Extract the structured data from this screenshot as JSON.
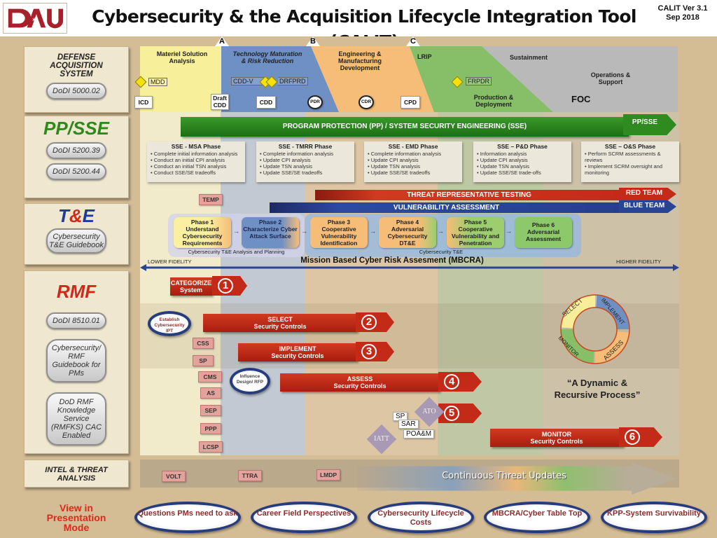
{
  "header": {
    "logo_text": "DAU",
    "title": "Cybersecurity & the Acquisition Lifecycle Integration Tool (CALIT)",
    "version_line1": "CALIT Ver 3.1",
    "version_line2": "Sep 2018"
  },
  "left_panel": {
    "das": {
      "title_lines": [
        "DEFENSE",
        "ACQUISITION",
        "SYSTEM"
      ],
      "buttons": [
        "DoDI 5000.02"
      ]
    },
    "ppsse": {
      "title": "PP/SSE",
      "buttons": [
        "DoDI 5200.39",
        "DoDI 5200.44"
      ]
    },
    "te": {
      "title_t": "T",
      "title_amp": "&",
      "title_e": "E",
      "buttons": [
        "Cybersecurity T&E Guidebook"
      ]
    },
    "rmf": {
      "title": "RMF",
      "buttons": [
        "DoDI 8510.01",
        "Cybersecurity/ RMF Guidebook for PMs",
        "DoD RMF Knowledge Service (RMFKS) CAC Enabled"
      ]
    },
    "intel": {
      "title": "INTEL & THREAT ANALYSIS"
    },
    "presentation": "View in Presentation Mode"
  },
  "lifecycle": {
    "milestones": [
      "A",
      "B",
      "C"
    ],
    "phases": [
      {
        "name": "Materiel Solution Analysis",
        "color": "#f8ef9a"
      },
      {
        "name": "Technology Maturation & Risk Reduction",
        "color": "#6f90c4"
      },
      {
        "name": "Engineering & Manufacturing Development",
        "color": "#f6bd78"
      },
      {
        "name": "LRIP",
        "color": "#86bf68"
      },
      {
        "name": "Sustainment",
        "color": "#b9b9b9"
      }
    ],
    "production": "Production & Deployment",
    "ops": "Operations & Support",
    "foc": "FOC",
    "decision_points": [
      "MDD",
      "CDD-V",
      "DRFPRD",
      "FRPDR"
    ],
    "documents": [
      "ICD",
      "Draft CDD",
      "CDD",
      "CPD"
    ],
    "reviews": [
      "PDR",
      "CDR"
    ]
  },
  "ppsse": {
    "banner": "PROGRAM PROTECTION (PP) / SYSTEM SECURITY ENGINEERING (SSE)",
    "tag": "PP/SSE",
    "phases": [
      {
        "title": "SSE - MSA Phase",
        "items": [
          "Complete initial information analysis",
          "Conduct an initial CPI analysis",
          "Conduct an initial TSN analysis",
          "Conduct SSE/SE tradeoffs"
        ]
      },
      {
        "title": "SSE - TMRR Phase",
        "items": [
          "Complete information analysis",
          "Update CPI analysis",
          "Update TSN analysis",
          "Update SSE/SE tradeoffs"
        ]
      },
      {
        "title": "SSE - EMD Phase",
        "items": [
          "Complete information analysis",
          "Update CPI analysis",
          "Update TSN analysis",
          "Update SSE/SE tradeoffs"
        ]
      },
      {
        "title": "SSE – P&D Phase",
        "items": [
          "Information analysis",
          "Update CPI analysis",
          "Update TSN analysis",
          "Update SSE/SE trade-offs"
        ]
      },
      {
        "title": "SSE – O&S Phase",
        "items": [
          "Perform SCRM assessments & reviews",
          "Implement SCRM oversight and monitoring"
        ]
      }
    ]
  },
  "te": {
    "temp": "TEMP",
    "threat_bar": "THREAT REPRESENTATIVE TESTING",
    "red_team": "RED TEAM",
    "vuln_bar": "VULNERABILITY ASSESSMENT",
    "blue_team": "BLUE TEAM",
    "phases": [
      {
        "n": "Phase 1",
        "text": "Understand Cybersecurity Requirements"
      },
      {
        "n": "Phase 2",
        "text": "Characterize Cyber Attack Surface"
      },
      {
        "n": "Phase 3",
        "text": "Cooperative Vulnerability Identification"
      },
      {
        "n": "Phase 4",
        "text": "Adversarial Cybersecurity DT&E"
      },
      {
        "n": "Phase 5",
        "text": "Cooperative Vulnerability and Penetration"
      },
      {
        "n": "Phase 6",
        "text": "Adversarial Assessment"
      }
    ],
    "group1": "Cybersecurity T&E Analysis and Planning",
    "group2": "Cybersecurity T&E",
    "lower": "LOWER FIDELITY",
    "mbcra": "Mission Based Cyber Risk Assesment (MBCRA)",
    "higher": "HIGHER FIDELITY"
  },
  "rmf": {
    "steps": [
      {
        "num": "1",
        "l1": "CATEGORIZE",
        "l2": "System"
      },
      {
        "num": "2",
        "l1": "SELECT",
        "l2": "Security Controls"
      },
      {
        "num": "3",
        "l1": "IMPLEMENT",
        "l2": "Security Controls"
      },
      {
        "num": "4",
        "l1": "ASSESS",
        "l2": "Security Controls"
      },
      {
        "num": "5",
        "l1": "",
        "l2": ""
      },
      {
        "num": "6",
        "l1": "MONITOR",
        "l2": "Security Controls"
      }
    ],
    "establish_ipt": "Establish Cybersecurity IPT",
    "influence": "Influence Design/ RFP",
    "docs": [
      "CSS",
      "SP",
      "CMS",
      "AS",
      "SEP",
      "PPP",
      "LCSP"
    ],
    "ato": "ATO",
    "iatt": "IATT",
    "package": [
      "SP",
      "SAR",
      "POA&M"
    ],
    "cycle": [
      "SELECT",
      "IMPLEMENT",
      "ASSESS",
      "MONITOR"
    ],
    "cycle_caption": "“A Dynamic & Recursive Process”"
  },
  "intel": {
    "docs": [
      "VOLT",
      "TTRA",
      "LMDP"
    ],
    "continuous": "Continuous Threat Updates"
  },
  "bottom_links": [
    "Questions PMs need to ask",
    "Career Field Perspectives",
    "Cybersecurity Lifecycle Costs",
    "MBCRA/Cyber Table Top",
    "KPP-System Survivability"
  ]
}
